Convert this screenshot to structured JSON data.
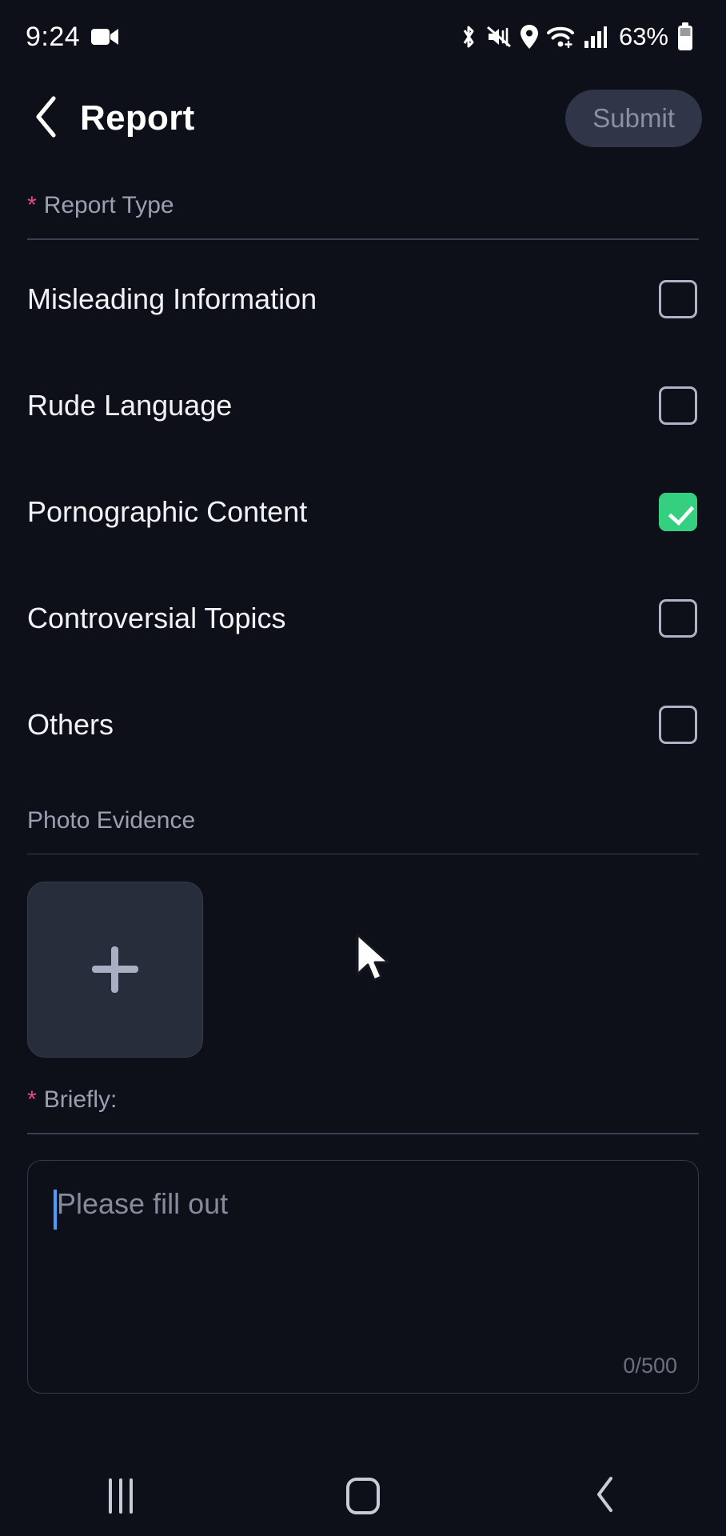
{
  "status_bar": {
    "time": "9:24",
    "battery_percent": "63%",
    "icons": [
      "video-camera-icon",
      "bluetooth-icon",
      "vibrate-mute-icon",
      "location-icon",
      "wifi-icon",
      "cellular-signal-icon",
      "battery-icon"
    ]
  },
  "header": {
    "back_icon": "chevron-left-icon",
    "title": "Report",
    "submit_label": "Submit"
  },
  "report_type": {
    "label": "Report Type",
    "required_marker": "*",
    "options": [
      {
        "label": "Misleading Information",
        "checked": false
      },
      {
        "label": "Rude Language",
        "checked": false
      },
      {
        "label": "Pornographic Content",
        "checked": true
      },
      {
        "label": "Controversial Topics",
        "checked": false
      },
      {
        "label": "Others",
        "checked": false
      }
    ]
  },
  "photo_evidence": {
    "label": "Photo Evidence",
    "add_icon": "plus-icon"
  },
  "briefly": {
    "label": "Briefly:",
    "required_marker": "*",
    "value": "",
    "placeholder": "Please fill out",
    "counter": "0/500",
    "max_length": 500
  },
  "nav_bar": {
    "recents": "recent-apps-icon",
    "home": "home-icon",
    "back": "back-icon"
  },
  "colors": {
    "background": "#0d1019",
    "accent_checked": "#35d07f",
    "required_star": "#e8458b",
    "caret": "#4a9eff",
    "submit_bg": "#303548"
  }
}
